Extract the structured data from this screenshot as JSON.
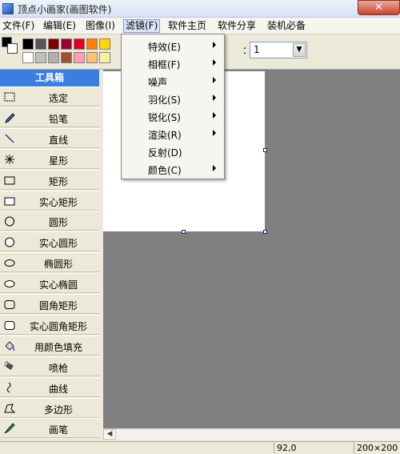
{
  "window": {
    "title": "顶点小画家(画图软件)",
    "close_glyph": "✕"
  },
  "menubar": [
    {
      "label": "文件(F)",
      "name": "menu-file"
    },
    {
      "label": "编辑(E)",
      "name": "menu-edit"
    },
    {
      "label": "图像(I)",
      "name": "menu-image"
    },
    {
      "label": "滤镜(F)",
      "name": "menu-filter"
    },
    {
      "label": "软件主页",
      "name": "menu-homepage"
    },
    {
      "label": "软件分享",
      "name": "menu-share"
    },
    {
      "label": "装机必备",
      "name": "menu-essentials"
    }
  ],
  "palette": {
    "foreground": "#000000",
    "background": "#ffffff",
    "row1": [
      "#000000",
      "#555555",
      "#800000",
      "#a00030",
      "#e00020",
      "#ff7f00",
      "#ffd700"
    ],
    "row2": [
      "#ffffff",
      "#c0c0c0",
      "#b0b0b0",
      "#a05030",
      "#ffa0b0",
      "#ffc070",
      "#fff0a0"
    ]
  },
  "toolbar": {
    "colon": "：",
    "size_value": "1",
    "dropdown_arrow": "▼"
  },
  "toolbox": {
    "header": "工具箱",
    "tools": [
      {
        "label": "选定",
        "icon": "select-icon"
      },
      {
        "label": "铅笔",
        "icon": "pencil-icon"
      },
      {
        "label": "直线",
        "icon": "line-icon"
      },
      {
        "label": "星形",
        "icon": "star-icon"
      },
      {
        "label": "矩形",
        "icon": "rectangle-icon"
      },
      {
        "label": "实心矩形",
        "icon": "filled-rectangle-icon"
      },
      {
        "label": "圆形",
        "icon": "circle-icon"
      },
      {
        "label": "实心圆形",
        "icon": "filled-circle-icon"
      },
      {
        "label": "椭圆形",
        "icon": "ellipse-icon"
      },
      {
        "label": "实心椭圆",
        "icon": "filled-ellipse-icon"
      },
      {
        "label": "圆角矩形",
        "icon": "rounded-rectangle-icon"
      },
      {
        "label": "实心圆角矩形",
        "icon": "filled-rounded-rectangle-icon"
      },
      {
        "label": "用颜色填充",
        "icon": "fill-bucket-icon"
      },
      {
        "label": "喷枪",
        "icon": "airbrush-icon"
      },
      {
        "label": "曲线",
        "icon": "curve-icon"
      },
      {
        "label": "多边形",
        "icon": "polygon-icon"
      },
      {
        "label": "画笔",
        "icon": "brush-icon"
      }
    ]
  },
  "filter_menu": [
    {
      "label": "特效(E)",
      "submenu": true
    },
    {
      "label": "相框(F)",
      "submenu": true
    },
    {
      "label": "噪声",
      "submenu": true
    },
    {
      "label": "羽化(S)",
      "submenu": true
    },
    {
      "label": "锐化(S)",
      "submenu": true
    },
    {
      "label": "渲染(R)",
      "submenu": true
    },
    {
      "label": "反射(D)",
      "submenu": false
    },
    {
      "label": "颜色(C)",
      "submenu": true
    }
  ],
  "scrollbar": {
    "left_arrow": "◀"
  },
  "statusbar": {
    "coords": "92,0",
    "canvas_size": "200×200"
  },
  "colors": {
    "toolbox_header": "#3c7ee0",
    "workspace": "#808080",
    "canvas": "#ffffff"
  }
}
